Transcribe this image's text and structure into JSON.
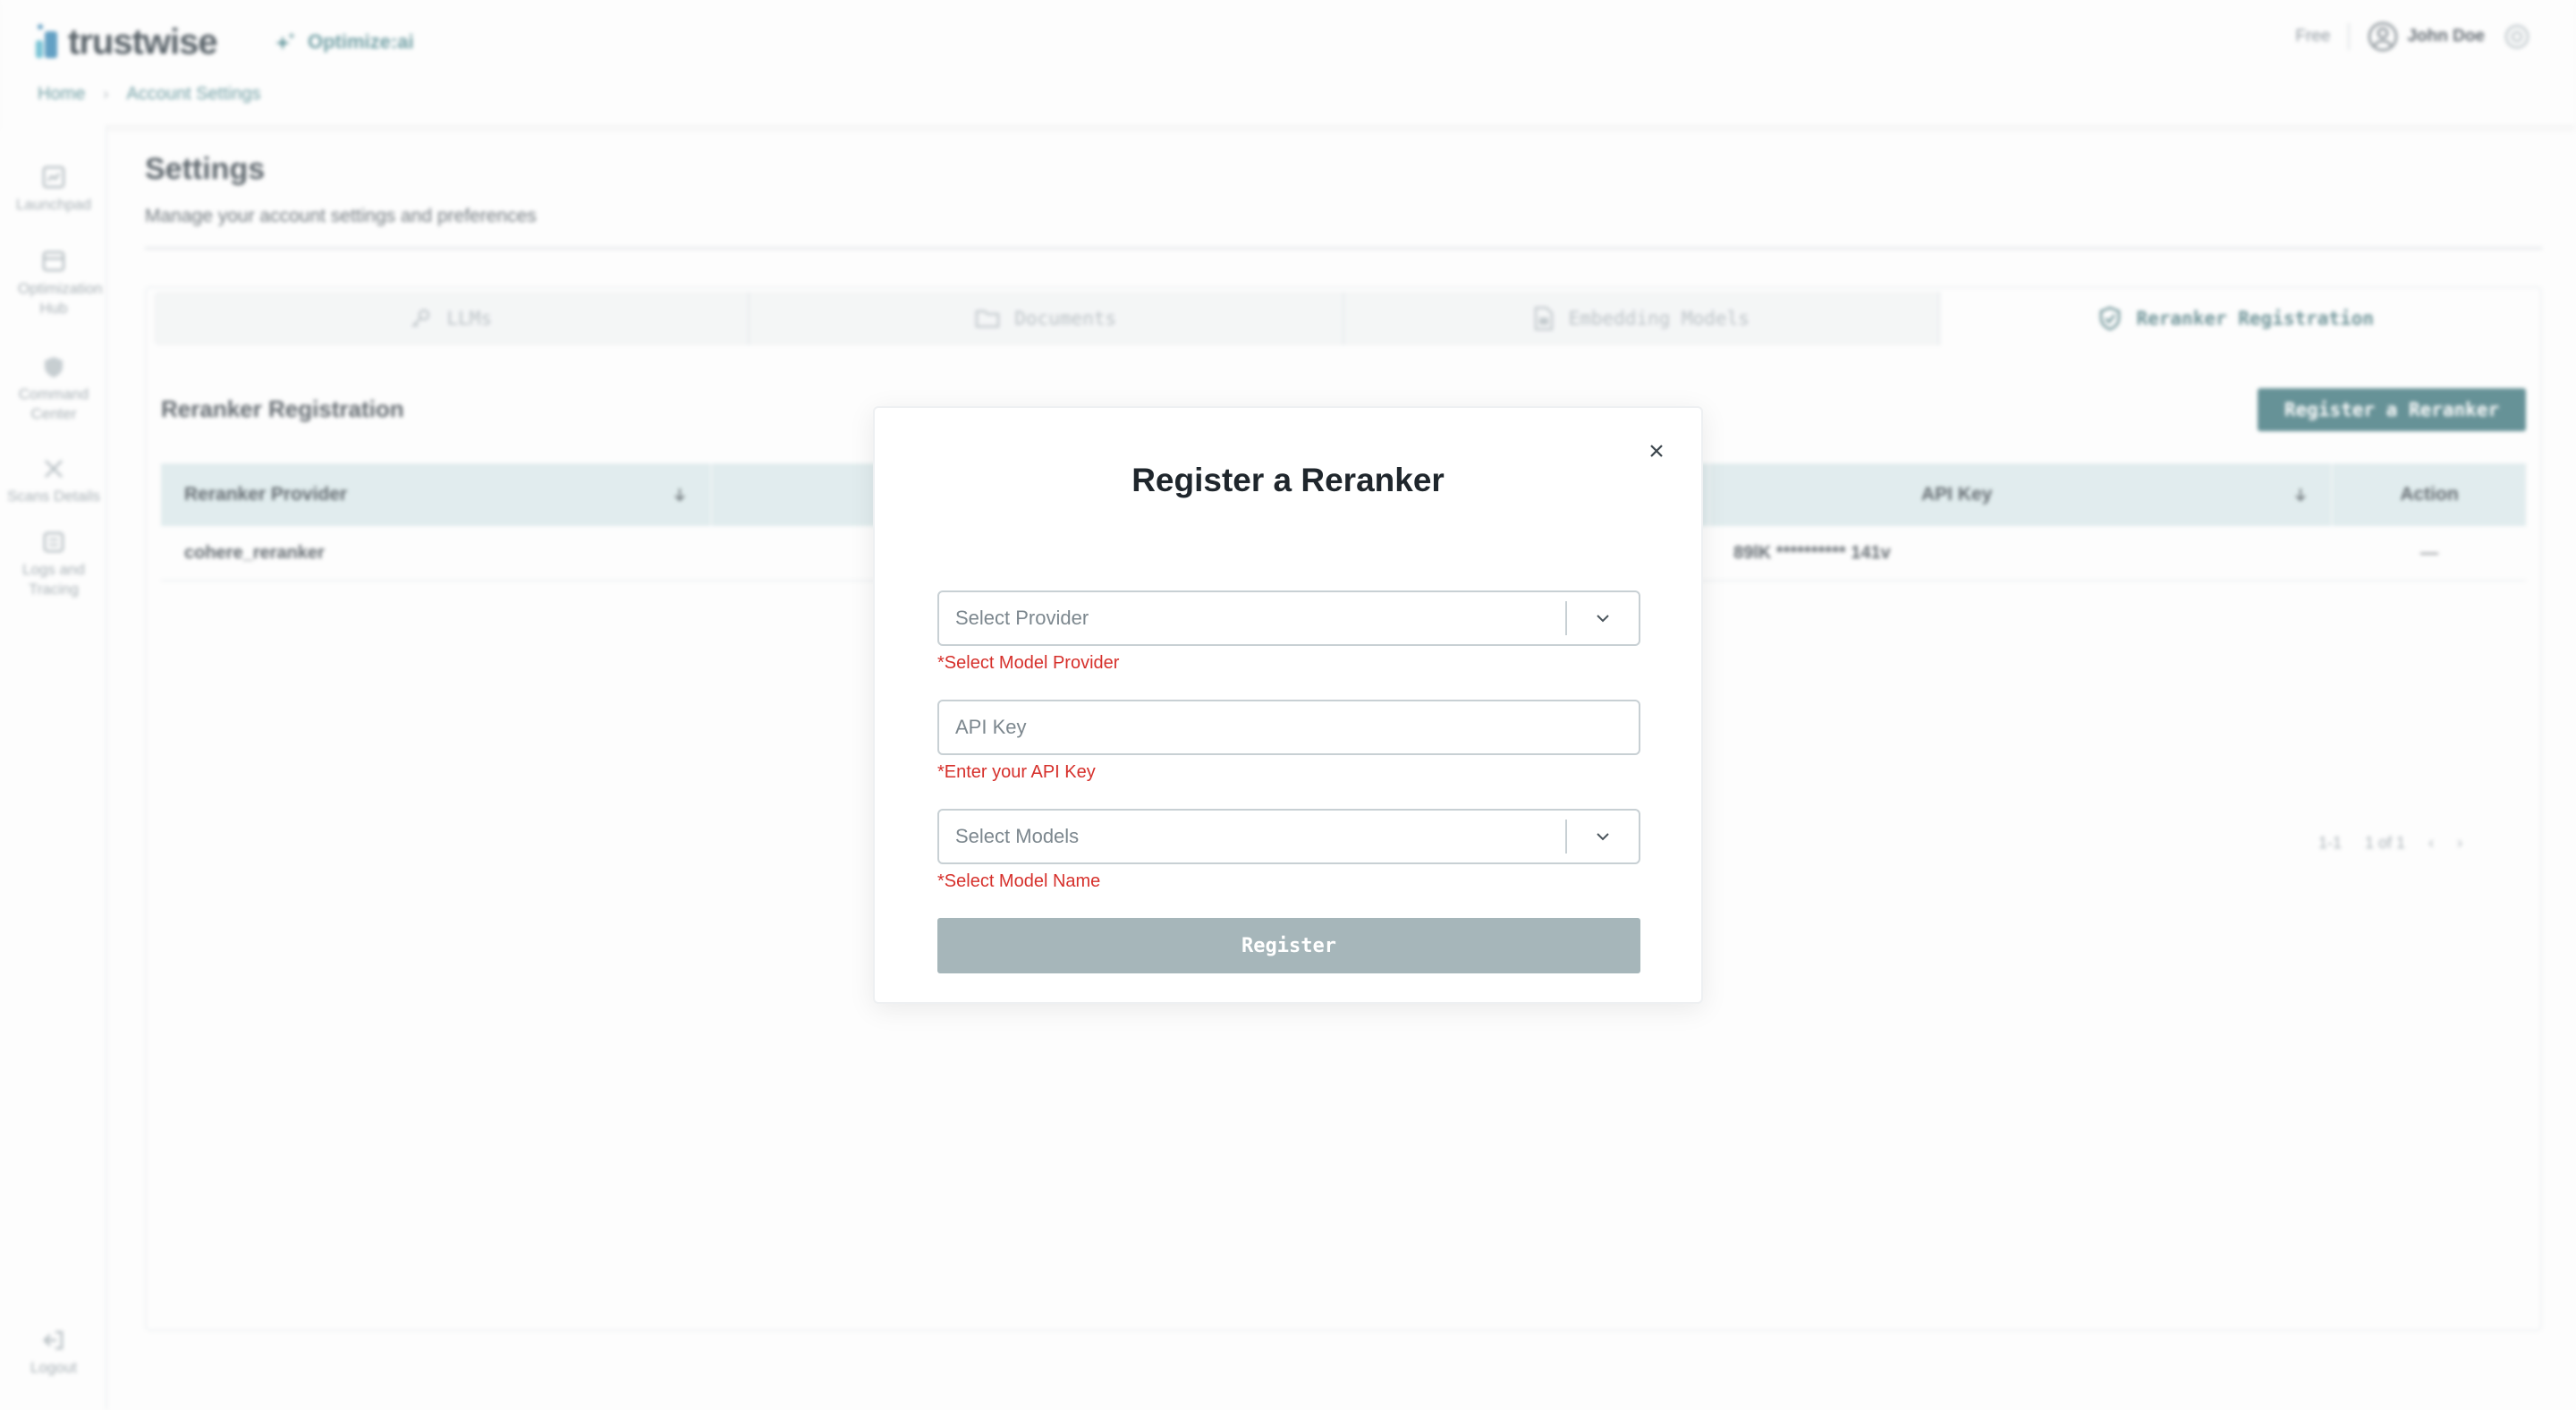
{
  "header": {
    "logo_text": "trustwise",
    "product_name": "Optimize:ai",
    "plan": "Free",
    "user_name": "John Doe"
  },
  "breadcrumb": [
    "Home",
    "Account Settings"
  ],
  "sidebar": {
    "items": [
      {
        "label": "Launchpad",
        "icon": "launchpad-icon"
      },
      {
        "label": "Optimization Hub",
        "icon": "optimization-hub-icon"
      },
      {
        "label": "Command Center",
        "icon": "shield-icon"
      },
      {
        "label": "Scans Details",
        "icon": "scan-icon"
      },
      {
        "label": "Logs and Tracing",
        "icon": "logs-icon"
      }
    ],
    "logout_label": "Logout"
  },
  "page": {
    "title": "Settings",
    "subtitle": "Manage your account settings and preferences"
  },
  "tabs": [
    {
      "label": "LLMs",
      "icon": "key-icon"
    },
    {
      "label": "Documents",
      "icon": "folder-icon"
    },
    {
      "label": "Embedding Models",
      "icon": "file-icon"
    },
    {
      "label": "Reranker Registration",
      "icon": "shield-check-icon",
      "active": true
    }
  ],
  "section": {
    "title": "Reranker Registration",
    "register_button": "Register a Reranker"
  },
  "table": {
    "columns": [
      "Reranker Provider",
      "API Key",
      "Action"
    ],
    "rows": [
      {
        "provider": "cohere_reranker",
        "api_key": "89lK ********** 141v",
        "action": "—"
      }
    ]
  },
  "pagination": {
    "per_page": "1-1",
    "page_info": "1 of 1",
    "prev": "‹",
    "next": "›"
  },
  "modal": {
    "title": "Register a Reranker",
    "provider_placeholder": "Select Provider",
    "provider_error": "*Select Model Provider",
    "api_key_placeholder": "API Key",
    "api_key_error": "*Enter your API Key",
    "models_placeholder": "Select Models",
    "models_error": "*Select Model Name",
    "submit_label": "Register"
  },
  "colors": {
    "accent": "#2f6b72",
    "error": "#d6302b",
    "disabled_button": "#a6b6ba",
    "table_header": "#d8e8ea"
  }
}
